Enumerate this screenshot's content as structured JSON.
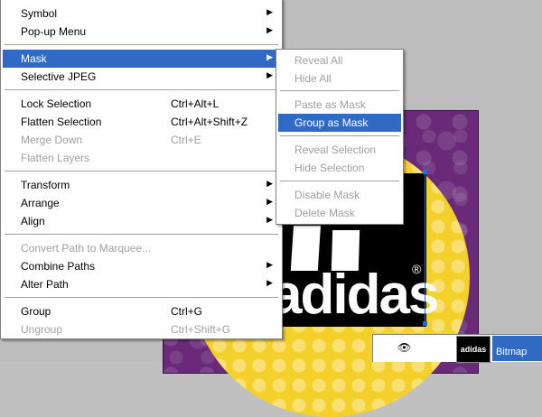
{
  "menu": {
    "items": [
      {
        "label": "Symbol",
        "shortcut": "",
        "submenu": true,
        "disabled": false
      },
      {
        "label": "Pop-up Menu",
        "shortcut": "",
        "submenu": true,
        "disabled": false
      },
      {
        "label": "Mask",
        "shortcut": "",
        "submenu": true,
        "disabled": false,
        "highlighted": true
      },
      {
        "label": "Selective JPEG",
        "shortcut": "",
        "submenu": true,
        "disabled": false
      },
      {
        "label": "Lock Selection",
        "shortcut": "Ctrl+Alt+L",
        "disabled": false
      },
      {
        "label": "Flatten Selection",
        "shortcut": "Ctrl+Alt+Shift+Z",
        "disabled": false
      },
      {
        "label": "Merge Down",
        "shortcut": "Ctrl+E",
        "disabled": true
      },
      {
        "label": "Flatten Layers",
        "shortcut": "",
        "disabled": true
      },
      {
        "label": "Transform",
        "shortcut": "",
        "submenu": true,
        "disabled": false
      },
      {
        "label": "Arrange",
        "shortcut": "",
        "submenu": true,
        "disabled": false
      },
      {
        "label": "Align",
        "shortcut": "",
        "submenu": true,
        "disabled": false
      },
      {
        "label": "Convert Path to Marquee...",
        "shortcut": "",
        "disabled": true
      },
      {
        "label": "Combine Paths",
        "shortcut": "",
        "submenu": true,
        "disabled": false
      },
      {
        "label": "Alter Path",
        "shortcut": "",
        "submenu": true,
        "disabled": false
      },
      {
        "label": "Group",
        "shortcut": "Ctrl+G",
        "disabled": false
      },
      {
        "label": "Ungroup",
        "shortcut": "Ctrl+Shift+G",
        "disabled": true
      }
    ]
  },
  "mask_submenu": {
    "items": [
      {
        "label": "Reveal All",
        "disabled": true
      },
      {
        "label": "Hide All",
        "disabled": true
      },
      {
        "label": "Paste as Mask",
        "disabled": true
      },
      {
        "label": "Group as Mask",
        "disabled": false,
        "highlighted": true
      },
      {
        "label": "Reveal Selection",
        "disabled": true
      },
      {
        "label": "Hide Selection",
        "disabled": true
      },
      {
        "label": "Disable Mask",
        "disabled": true
      },
      {
        "label": "Delete Mask",
        "disabled": true
      }
    ]
  },
  "artwork": {
    "logo_text": "adidas",
    "registered_mark": "®",
    "thumb_text": "adidas"
  },
  "layers": {
    "selected_layer_label": "Bitmap",
    "eye_icon": "eye-icon"
  },
  "colors": {
    "highlight": "#316ac5",
    "menu_bg": "#ffffff",
    "disabled_text": "#a0a0a0",
    "artboard_purple": "#6a2a79",
    "circle_yellow": "#f4d02a"
  },
  "icons": {
    "submenu_arrow": "▶"
  }
}
